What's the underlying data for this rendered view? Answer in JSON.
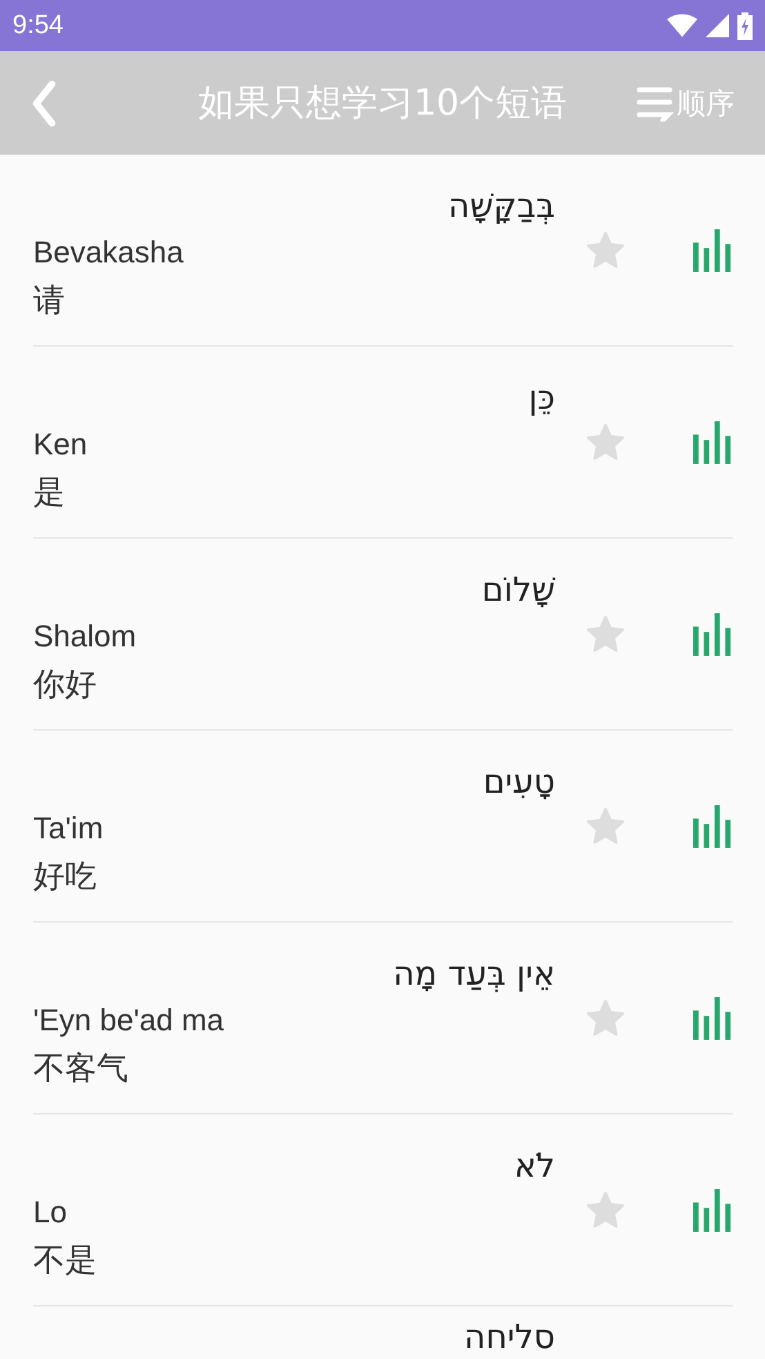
{
  "status_bar": {
    "time": "9:54"
  },
  "toolbar": {
    "title": "如果只想学习10个短语",
    "sort_label": "顺序"
  },
  "phrases": [
    {
      "hebrew": "בְּבַקָּשָׁה",
      "transliteration": "Bevakasha",
      "chinese": "请",
      "starred": false
    },
    {
      "hebrew": "כֵּן",
      "transliteration": "Ken",
      "chinese": "是",
      "starred": false
    },
    {
      "hebrew": "שָׁלוֹם",
      "transliteration": "Shalom",
      "chinese": "你好",
      "starred": false
    },
    {
      "hebrew": "טָעִים",
      "transliteration": "Ta'im",
      "chinese": "好吃",
      "starred": false
    },
    {
      "hebrew": "אֵין בְּעַד מָה",
      "transliteration": "'Eyn be'ad ma",
      "chinese": "不客气",
      "starred": false
    },
    {
      "hebrew": "לֹא",
      "transliteration": "Lo",
      "chinese": "不是",
      "starred": false
    },
    {
      "hebrew": "סליחה"
    }
  ]
}
